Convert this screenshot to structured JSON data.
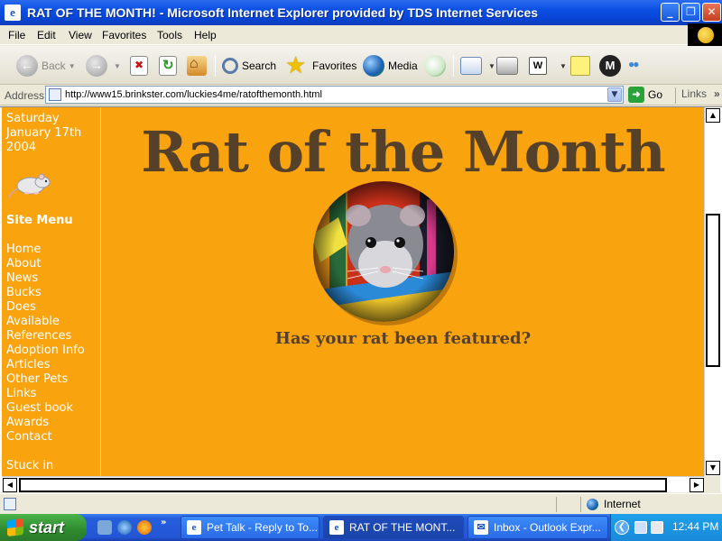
{
  "window": {
    "title": "RAT OF THE MONTH! - Microsoft Internet Explorer provided by TDS Internet Services",
    "minimize": "_",
    "maximize": "❐",
    "close": "✕"
  },
  "menubar": {
    "items": [
      "File",
      "Edit",
      "View",
      "Favorites",
      "Tools",
      "Help"
    ]
  },
  "toolbar": {
    "back": "Back",
    "search": "Search",
    "favorites": "Favorites",
    "media": "Media",
    "edit_glyph": "W"
  },
  "address": {
    "label": "Address",
    "url": "http://www15.brinkster.com/luckies4me/ratofthemonth.html",
    "go": "Go",
    "links": "Links",
    "links_more": "»"
  },
  "page": {
    "sidebar": {
      "date_lines": [
        "Saturday",
        "January 17th",
        "2004"
      ],
      "menu_heading": "Site Menu",
      "menu_items": [
        "Home",
        "About",
        "News",
        "Bucks",
        "Does",
        "Available",
        "References",
        "Adoption Info",
        "Articles",
        "Other Pets",
        "Links",
        "Guest book",
        "Awards",
        "Contact"
      ],
      "footer_text": "Stuck in"
    },
    "heading": "Rat of the Month",
    "tagline": "Has your rat been featured?",
    "colors": {
      "background": "#f9a30f",
      "heading": "#55402a"
    }
  },
  "statusbar": {
    "zone": "Internet"
  },
  "taskbar": {
    "start": "start",
    "tasks": [
      "Pet Talk - Reply to To...",
      "RAT OF THE MONT...",
      "Inbox - Outlook Expr..."
    ],
    "clock": "12:44 PM",
    "more": "»"
  }
}
